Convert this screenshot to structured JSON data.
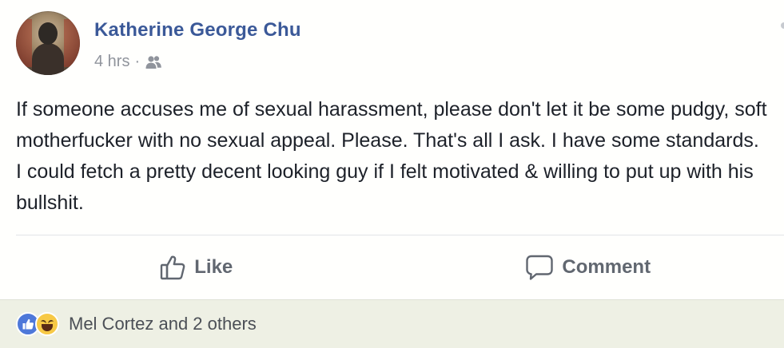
{
  "post": {
    "author": "Katherine George Chu",
    "time": "4 hrs",
    "separator": "·",
    "privacy_icon": "friends-icon",
    "text": "If someone accuses me of sexual harassment, please don't let it be some pudgy, soft motherfucker with no sexual appeal. Please. That's all I ask. I have some standards. I could fetch a pretty decent looking guy if I felt motivated & willing to put up with his bullshit."
  },
  "actions": {
    "like_label": "Like",
    "like_icon": "thumbs-up-icon",
    "comment_label": "Comment",
    "comment_icon": "speech-bubble-icon"
  },
  "reactions": {
    "icons": [
      "like-reaction-icon",
      "haha-reaction-icon"
    ],
    "summary": "Mel Cortez and 2 others"
  },
  "colors": {
    "author_name": "#3b5998",
    "meta_text": "#90949c",
    "body_text": "#1d2129",
    "action_text": "#616770",
    "reactions_bar_bg": "#eef0e4",
    "like_badge": "#4e78d9",
    "haha_badge": "#f7c946"
  }
}
